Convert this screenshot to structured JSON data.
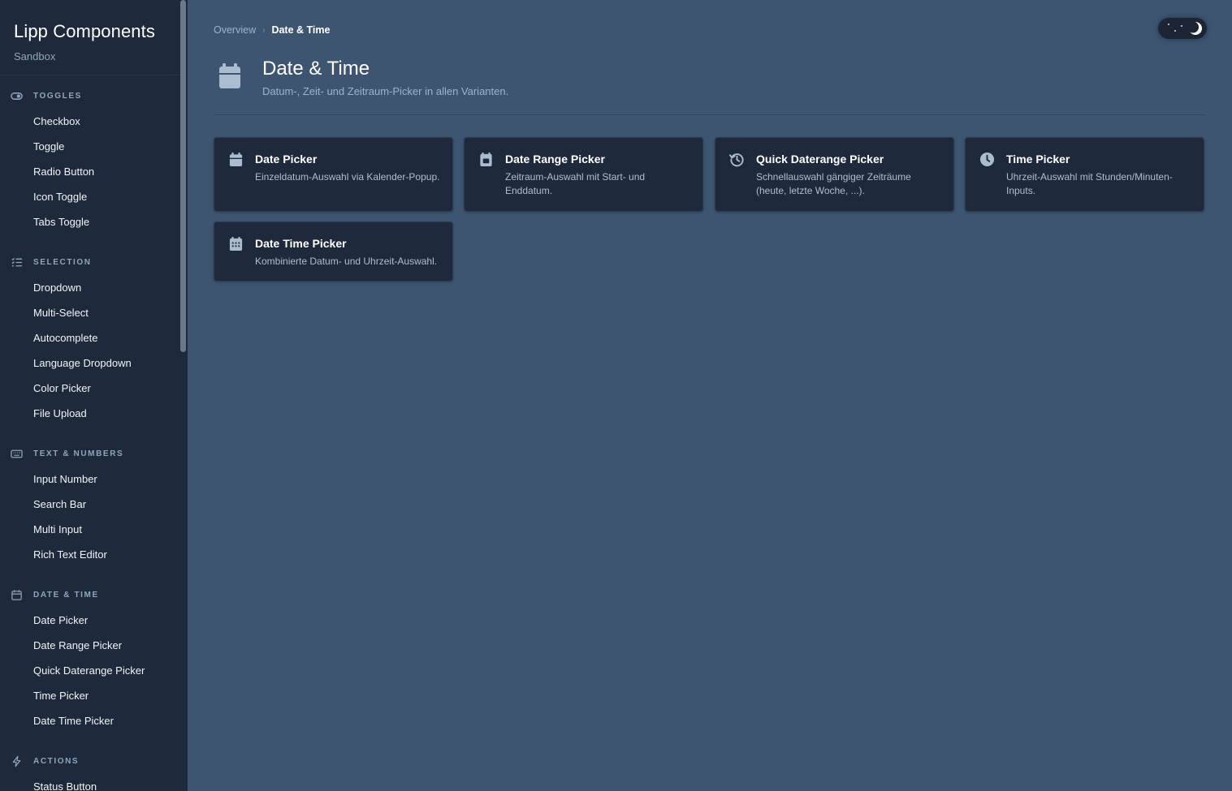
{
  "brand": {
    "title": "Lipp Components",
    "subtitle": "Sandbox"
  },
  "sidebar": {
    "sections": [
      {
        "label": "Toggles",
        "icon": "toggle-icon",
        "items": [
          "Checkbox",
          "Toggle",
          "Radio Button",
          "Icon Toggle",
          "Tabs Toggle"
        ]
      },
      {
        "label": "Selection",
        "icon": "list-check-icon",
        "items": [
          "Dropdown",
          "Multi-Select",
          "Autocomplete",
          "Language Dropdown",
          "Color Picker",
          "File Upload"
        ]
      },
      {
        "label": "Text & Numbers",
        "icon": "keyboard-icon",
        "items": [
          "Input Number",
          "Search Bar",
          "Multi Input",
          "Rich Text Editor"
        ]
      },
      {
        "label": "Date & Time",
        "icon": "calendar-icon",
        "items": [
          "Date Picker",
          "Date Range Picker",
          "Quick Daterange Picker",
          "Time Picker",
          "Date Time Picker"
        ]
      },
      {
        "label": "Actions",
        "icon": "bolt-icon",
        "items": [
          "Status Button"
        ]
      }
    ]
  },
  "breadcrumb": {
    "parent": "Overview",
    "separator": "›",
    "current": "Date & Time"
  },
  "header": {
    "title": "Date & Time",
    "description": "Datum-, Zeit- und Zeitraum-Picker in allen Varianten.",
    "icon": "calendar-icon"
  },
  "cards": [
    {
      "title": "Date Picker",
      "description": "Einzeldatum-Auswahl via Kalender-Popup.",
      "icon": "calendar-icon"
    },
    {
      "title": "Date Range Picker",
      "description": "Zeitraum-Auswahl mit Start- und Enddatum.",
      "icon": "calendar-range-icon"
    },
    {
      "title": "Quick Daterange Picker",
      "description": "Schnellauswahl gängiger Zeiträume (heute, letzte Woche, ...).",
      "icon": "history-icon"
    },
    {
      "title": "Time Picker",
      "description": "Uhrzeit-Auswahl mit Stunden/Minuten-Inputs.",
      "icon": "clock-icon"
    },
    {
      "title": "Date Time Picker",
      "description": "Kombinierte Datum- und Uhrzeit-Auswahl.",
      "icon": "calendar-days-icon"
    }
  ],
  "theme_toggle": {
    "mode": "dark",
    "icon": "moon-icon"
  },
  "colors": {
    "background": "#3d5570",
    "sidebar": "#1e2a3b",
    "card": "#1e2a3b",
    "text_muted": "#9fb3c8",
    "icon": "#a9bcd0"
  }
}
